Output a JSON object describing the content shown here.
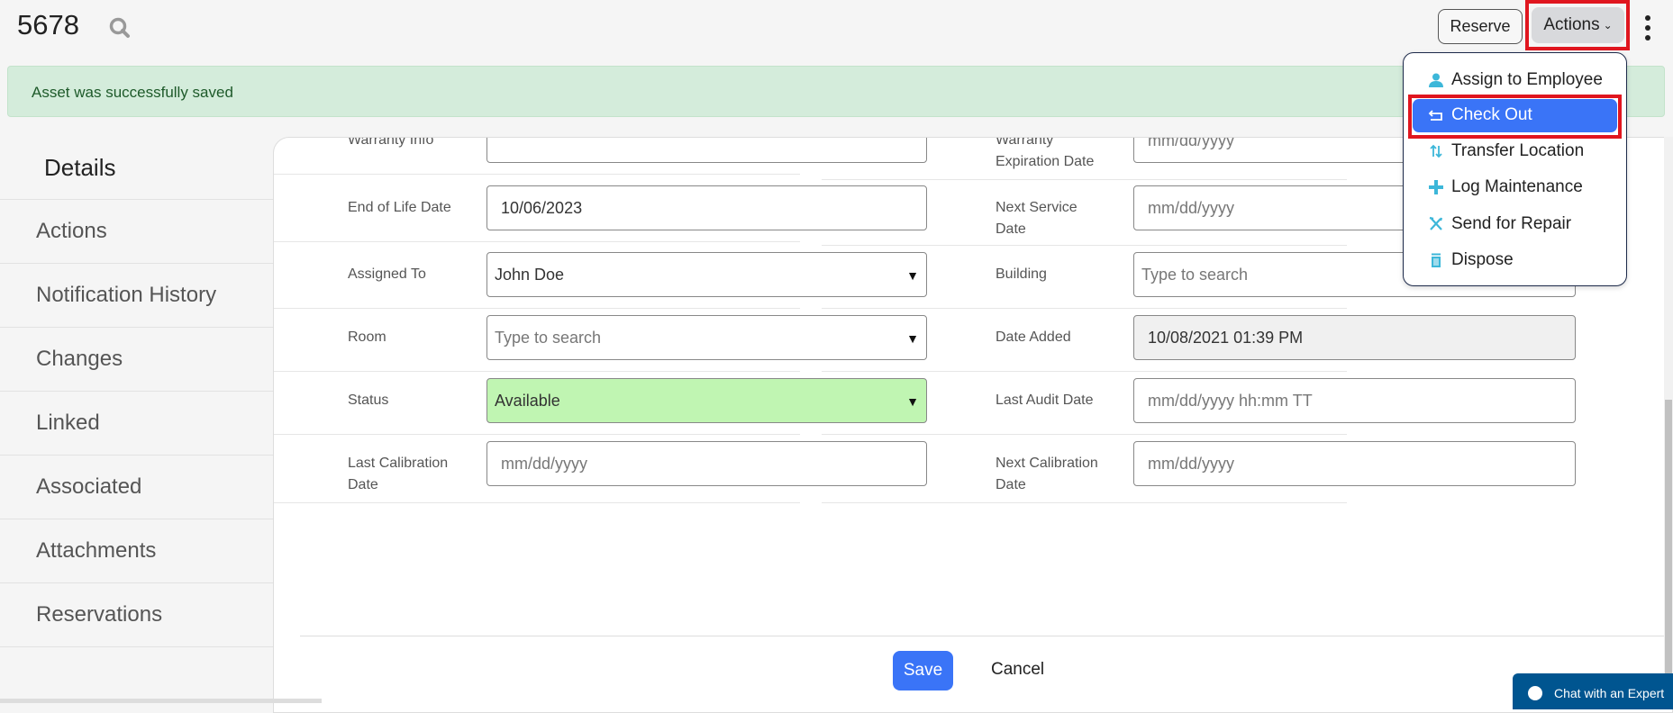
{
  "header": {
    "title": "5678",
    "reserve_label": "Reserve",
    "actions_label": "Actions"
  },
  "banner": {
    "message": "Asset was successfully saved"
  },
  "sidebar": {
    "items": [
      {
        "label": "Details",
        "active": true
      },
      {
        "label": "Actions"
      },
      {
        "label": "Notification History"
      },
      {
        "label": "Changes"
      },
      {
        "label": "Linked"
      },
      {
        "label": "Associated"
      },
      {
        "label": "Attachments"
      },
      {
        "label": "Reservations"
      }
    ]
  },
  "form": {
    "left": [
      {
        "label": "Warranty Info",
        "value": "",
        "placeholder": "",
        "type": "text"
      },
      {
        "label": "End of Life Date",
        "value": "10/06/2023",
        "type": "text"
      },
      {
        "label": "Assigned To",
        "value": "John Doe",
        "type": "select"
      },
      {
        "label": "Room",
        "value": "",
        "placeholder": "Type to search",
        "type": "select"
      },
      {
        "label": "Status",
        "value": "Available",
        "type": "select",
        "bg": "#c0f5b2"
      },
      {
        "label": "Last Calibration Date",
        "value": "",
        "placeholder": "mm/dd/yyyy",
        "type": "text"
      }
    ],
    "right": [
      {
        "label": "Warranty Expiration Date",
        "value": "",
        "placeholder": "mm/dd/yyyy",
        "type": "text"
      },
      {
        "label": "Next Service Date",
        "value": "",
        "placeholder": "mm/dd/yyyy",
        "type": "text"
      },
      {
        "label": "Building",
        "value": "",
        "placeholder": "Type to search",
        "type": "select"
      },
      {
        "label": "Date Added",
        "value": "10/08/2021 01:39 PM",
        "type": "readonly",
        "bg": "#f0f0f0"
      },
      {
        "label": "Last Audit Date",
        "value": "",
        "placeholder": "mm/dd/yyyy hh:mm TT",
        "type": "text"
      },
      {
        "label": "Next Calibration Date",
        "value": "",
        "placeholder": "mm/dd/yyyy",
        "type": "text"
      }
    ],
    "save_label": "Save",
    "cancel_label": "Cancel"
  },
  "actions_menu": {
    "items": [
      {
        "label": "Assign to Employee",
        "icon": "user-icon"
      },
      {
        "label": "Check Out",
        "icon": "return-arrow-icon",
        "highlighted": true
      },
      {
        "label": "Transfer Location",
        "icon": "transfer-arrows-icon"
      },
      {
        "label": "Log Maintenance",
        "icon": "plus-icon"
      },
      {
        "label": "Send for Repair",
        "icon": "tools-icon"
      },
      {
        "label": "Dispose",
        "icon": "trash-icon"
      }
    ]
  },
  "chat": {
    "label": "Chat with an Expert"
  },
  "colors": {
    "accent": "#3a74f7",
    "highlight_box": "#e0161f",
    "success_bg": "#d4ecdb",
    "status_available": "#c0f5b2",
    "icon": "#3db7d9",
    "chat_bg": "#005590"
  }
}
